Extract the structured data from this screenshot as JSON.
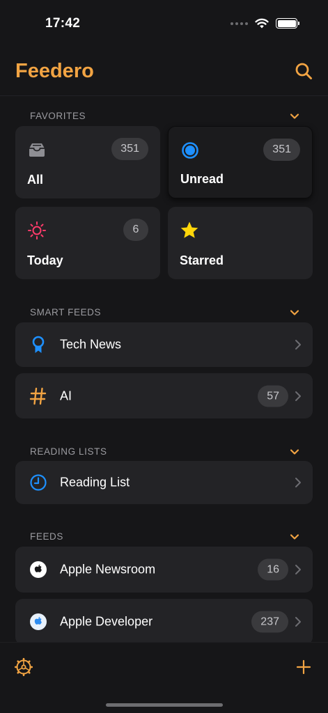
{
  "status": {
    "time": "17:42"
  },
  "header": {
    "title": "Feedero"
  },
  "favorites": {
    "title": "FAVORITES",
    "items": [
      {
        "label": "All",
        "count": "351",
        "icon": "inbox-tray-icon"
      },
      {
        "label": "Unread",
        "count": "351",
        "icon": "unread-dot-icon"
      },
      {
        "label": "Today",
        "count": "6",
        "icon": "sun-icon"
      },
      {
        "label": "Starred",
        "count": "",
        "icon": "star-icon"
      }
    ]
  },
  "smart_feeds": {
    "title": "SMART FEEDS",
    "items": [
      {
        "label": "Tech News",
        "count": "",
        "icon": "ribbon-icon"
      },
      {
        "label": "AI",
        "count": "57",
        "icon": "hashtag-icon"
      }
    ]
  },
  "reading_lists": {
    "title": "READING LISTS",
    "items": [
      {
        "label": "Reading List",
        "count": "",
        "icon": "clock-icon"
      }
    ]
  },
  "feeds": {
    "title": "FEEDS",
    "items": [
      {
        "label": "Apple Newsroom",
        "count": "16",
        "icon": "apple-logo-icon"
      },
      {
        "label": "Apple Developer",
        "count": "237",
        "icon": "apple-developer-icon"
      }
    ]
  },
  "colors": {
    "accent": "#f2a443",
    "blue": "#1e90ff",
    "pink": "#ff3b6b",
    "yellow": "#ffd60a"
  }
}
